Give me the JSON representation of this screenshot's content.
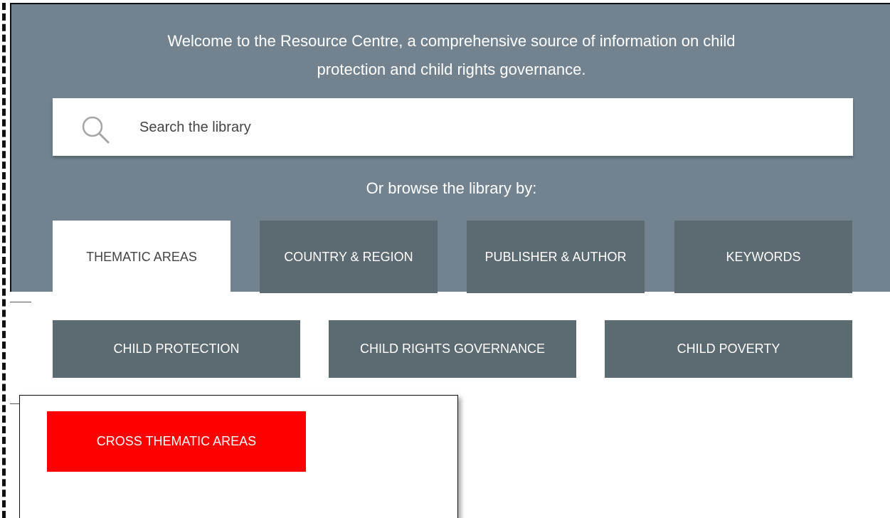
{
  "hero": {
    "welcome_line1": "Welcome to the Resource Centre, a comprehensive source of information on child",
    "welcome_line2": "protection and child rights governance.",
    "browse_label": "Or browse the library by:",
    "background_color": "#72838f"
  },
  "search": {
    "placeholder": "Search the library",
    "value": "",
    "icon": "search-icon"
  },
  "tabs": [
    {
      "label": "THEMATIC AREAS",
      "active": true
    },
    {
      "label": "COUNTRY & REGION",
      "active": false
    },
    {
      "label": "PUBLISHER & AUTHOR",
      "active": false
    },
    {
      "label": "KEYWORDS",
      "active": false
    }
  ],
  "topics": [
    {
      "label": "CHILD PROTECTION"
    },
    {
      "label": "CHILD RIGHTS GOVERNANCE"
    },
    {
      "label": "CHILD POVERTY"
    },
    {
      "label": "CROSS THEMATIC AREAS",
      "highlighted": true
    }
  ],
  "colors": {
    "tab_inactive": "#5c6a72",
    "topic_button": "#5c6a72",
    "highlight": "#ff0000"
  }
}
